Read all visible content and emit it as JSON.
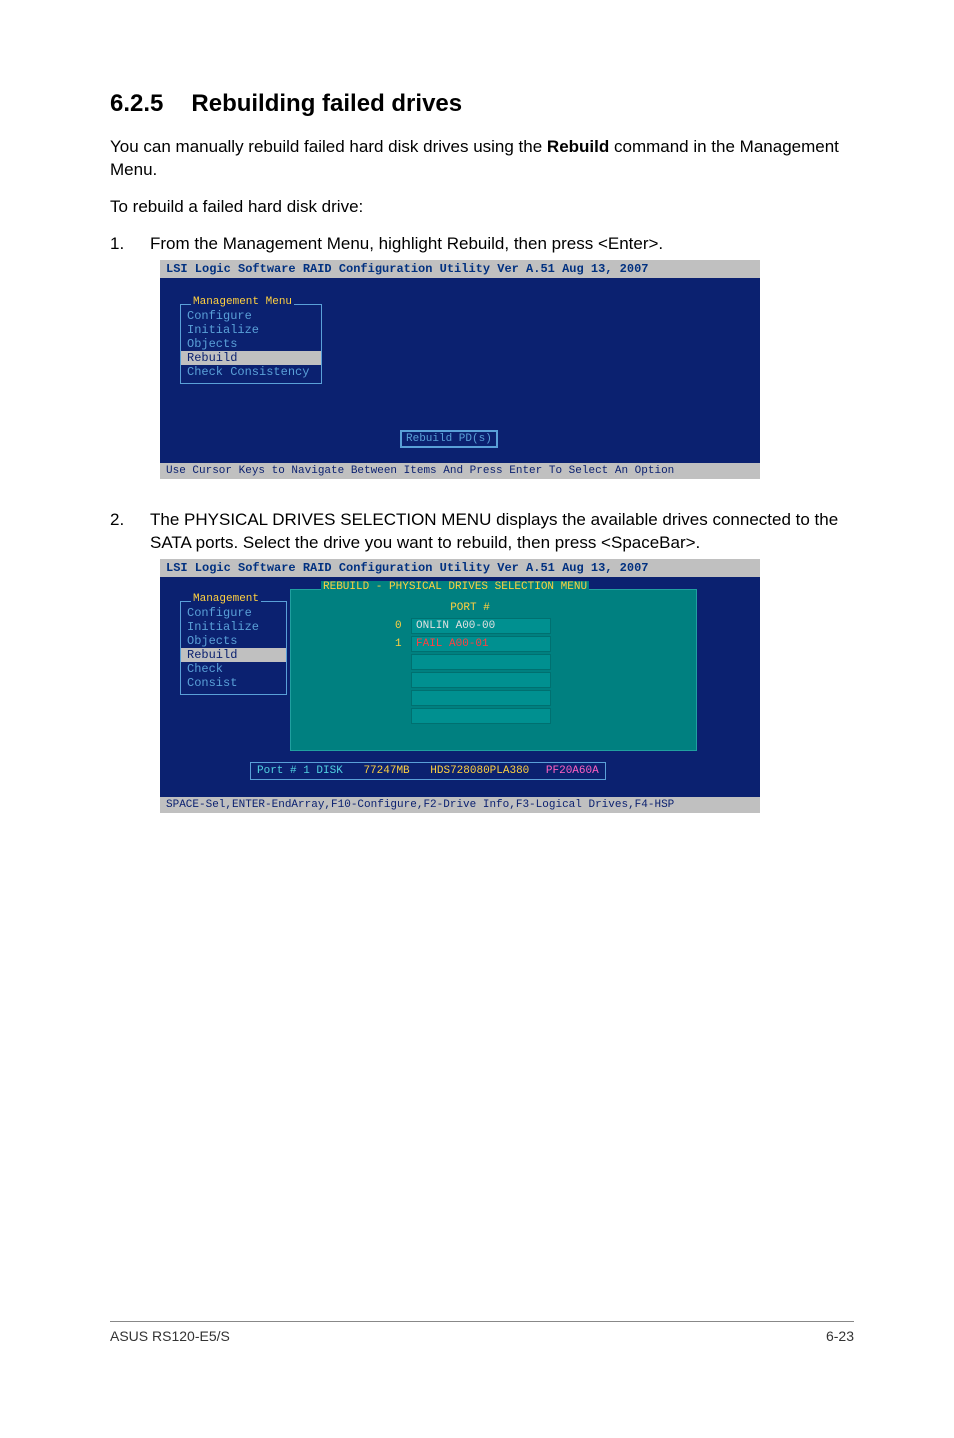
{
  "heading": {
    "number": "6.2.5",
    "title": "Rebuilding failed drives"
  },
  "intro1_a": "You can manually rebuild failed hard disk drives using the ",
  "intro1_bold": "Rebuild",
  "intro1_b": " command in the Management Menu.",
  "intro2": "To rebuild a failed hard disk drive:",
  "step1": {
    "num": "1.",
    "a": "From the ",
    "bold1": "Management Menu",
    "b": ", highlight ",
    "bold2": "Rebuild",
    "c": ", then press <Enter>."
  },
  "shot1": {
    "title": "LSI Logic Software RAID Configuration Utility Ver A.51 Aug 13, 2007",
    "menu_legend": "Management Menu",
    "items": [
      "Configure",
      "Initialize",
      "Objects",
      "Rebuild",
      "Check Consistency"
    ],
    "selected": 3,
    "rebuild_pd": "Rebuild PD(s)",
    "status": "Use Cursor Keys to Navigate Between Items And Press Enter To Select An Option"
  },
  "step2": {
    "num": "2.",
    "a": "The ",
    "bold": "PHYSICAL DRIVES SELECTION MENU",
    "b": " displays the available drives connected to the SATA ports. Select the drive you want to rebuild, then press <SpaceBar>."
  },
  "shot2": {
    "title": "LSI Logic Software RAID Configuration Utility Ver A.51 Aug 13, 2007",
    "menu_legend": "Management",
    "items": [
      "Configure",
      "Initialize",
      "Objects",
      "Rebuild",
      "Check Consist"
    ],
    "selected": 3,
    "rebuild_legend": "REBUILD - PHYSICAL DRIVES SELECTION MENU",
    "port_header": "PORT #",
    "rows": [
      {
        "idx": "0",
        "text": "ONLIN A00-00",
        "fail": false
      },
      {
        "idx": "1",
        "text": "FAIL  A00-01",
        "fail": true
      },
      {
        "idx": "",
        "text": "",
        "fail": false
      },
      {
        "idx": "",
        "text": "",
        "fail": false
      },
      {
        "idx": "",
        "text": "",
        "fail": false
      },
      {
        "idx": "",
        "text": "",
        "fail": false
      }
    ],
    "disk_info_a": "Port # 1 DISK",
    "disk_info_b": "77247MB",
    "disk_info_c": "HDS728080PLA380",
    "disk_info_d": "PF20A60A",
    "status": "SPACE-Sel,ENTER-EndArray,F10-Configure,F2-Drive Info,F3-Logical Drives,F4-HSP"
  },
  "footer": {
    "left": "ASUS RS120-E5/S",
    "right": "6-23"
  }
}
